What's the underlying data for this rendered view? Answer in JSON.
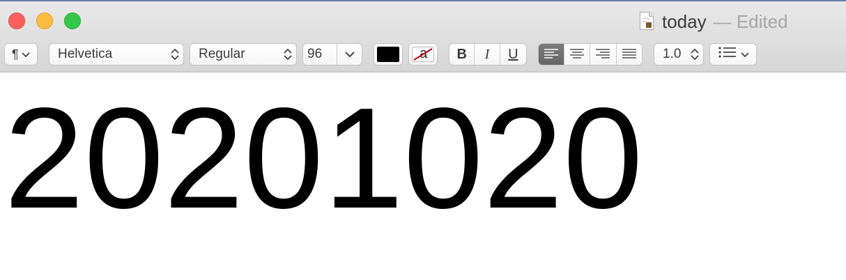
{
  "window": {
    "title": "today",
    "title_suffix": "— Edited"
  },
  "toolbar": {
    "paragraph_style_symbol": "¶",
    "font_family": "Helvetica",
    "typeface": "Regular",
    "font_size": "96",
    "text_color": "#000000",
    "highlight_symbol": "a",
    "bold_label": "B",
    "italic_label": "I",
    "underline_label": "U",
    "alignment_selected": "left",
    "line_spacing": "1.0"
  },
  "document": {
    "text": "20201020"
  },
  "colors": {
    "close": "#fc605c",
    "minimize": "#fdbc40",
    "zoom": "#34c84a",
    "strike_red": "#d0021b"
  }
}
